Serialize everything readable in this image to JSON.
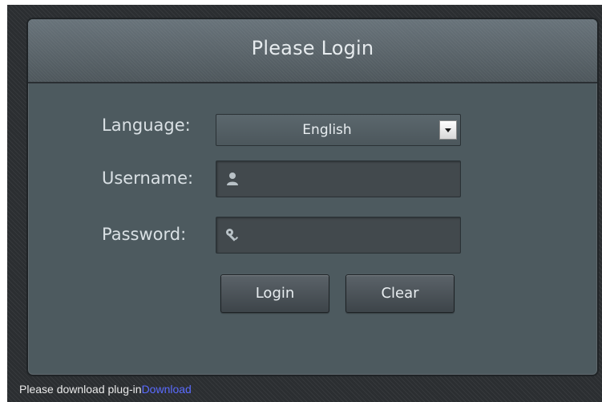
{
  "panel": {
    "title": "Please Login"
  },
  "form": {
    "language": {
      "label": "Language:",
      "selected": "English"
    },
    "username": {
      "label": "Username:",
      "value": "",
      "placeholder": ""
    },
    "password": {
      "label": "Password:",
      "value": "",
      "placeholder": ""
    }
  },
  "buttons": {
    "login": "Login",
    "clear": "Clear"
  },
  "footer": {
    "message": "Please download plug-in",
    "link": "Download"
  },
  "icons": {
    "username": "user-icon",
    "password": "key-icon",
    "select": "chevron-down-icon"
  },
  "colors": {
    "panel": "#4d5a5f",
    "link": "#5a6bff"
  }
}
